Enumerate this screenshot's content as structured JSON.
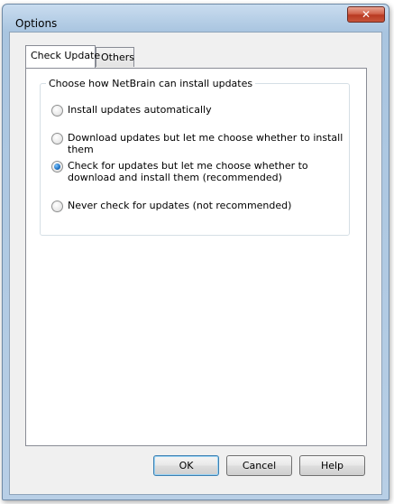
{
  "window": {
    "title": "Options",
    "close_glyph": "✕"
  },
  "tabs": [
    {
      "label": "Check Update",
      "active": true
    },
    {
      "label": "Others",
      "active": false
    }
  ],
  "group": {
    "legend": "Choose how NetBrain can install updates",
    "options": [
      {
        "label": "Install updates automatically",
        "checked": false
      },
      {
        "label": "Download updates but let me choose whether to install them",
        "checked": false
      },
      {
        "label": "Check for updates but let me choose whether to download and install them (recommended)",
        "checked": true
      },
      {
        "label": "Never check for updates (not recommended)",
        "checked": false
      }
    ]
  },
  "buttons": {
    "ok": "OK",
    "cancel": "Cancel",
    "help": "Help"
  },
  "colors": {
    "accent": "#1d6fc1",
    "titlebar": "#a9c5e0",
    "close": "#c8553b"
  }
}
